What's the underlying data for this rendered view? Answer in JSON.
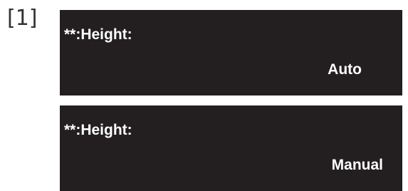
{
  "step_label": "[1]",
  "panels": [
    {
      "title": "**:Height:",
      "value": "Auto"
    },
    {
      "title": "**:Height:",
      "value": "Manual"
    }
  ],
  "colors": {
    "panel_background": "#231f20",
    "panel_text": "#ffffff",
    "step_label_text": "#333333"
  }
}
